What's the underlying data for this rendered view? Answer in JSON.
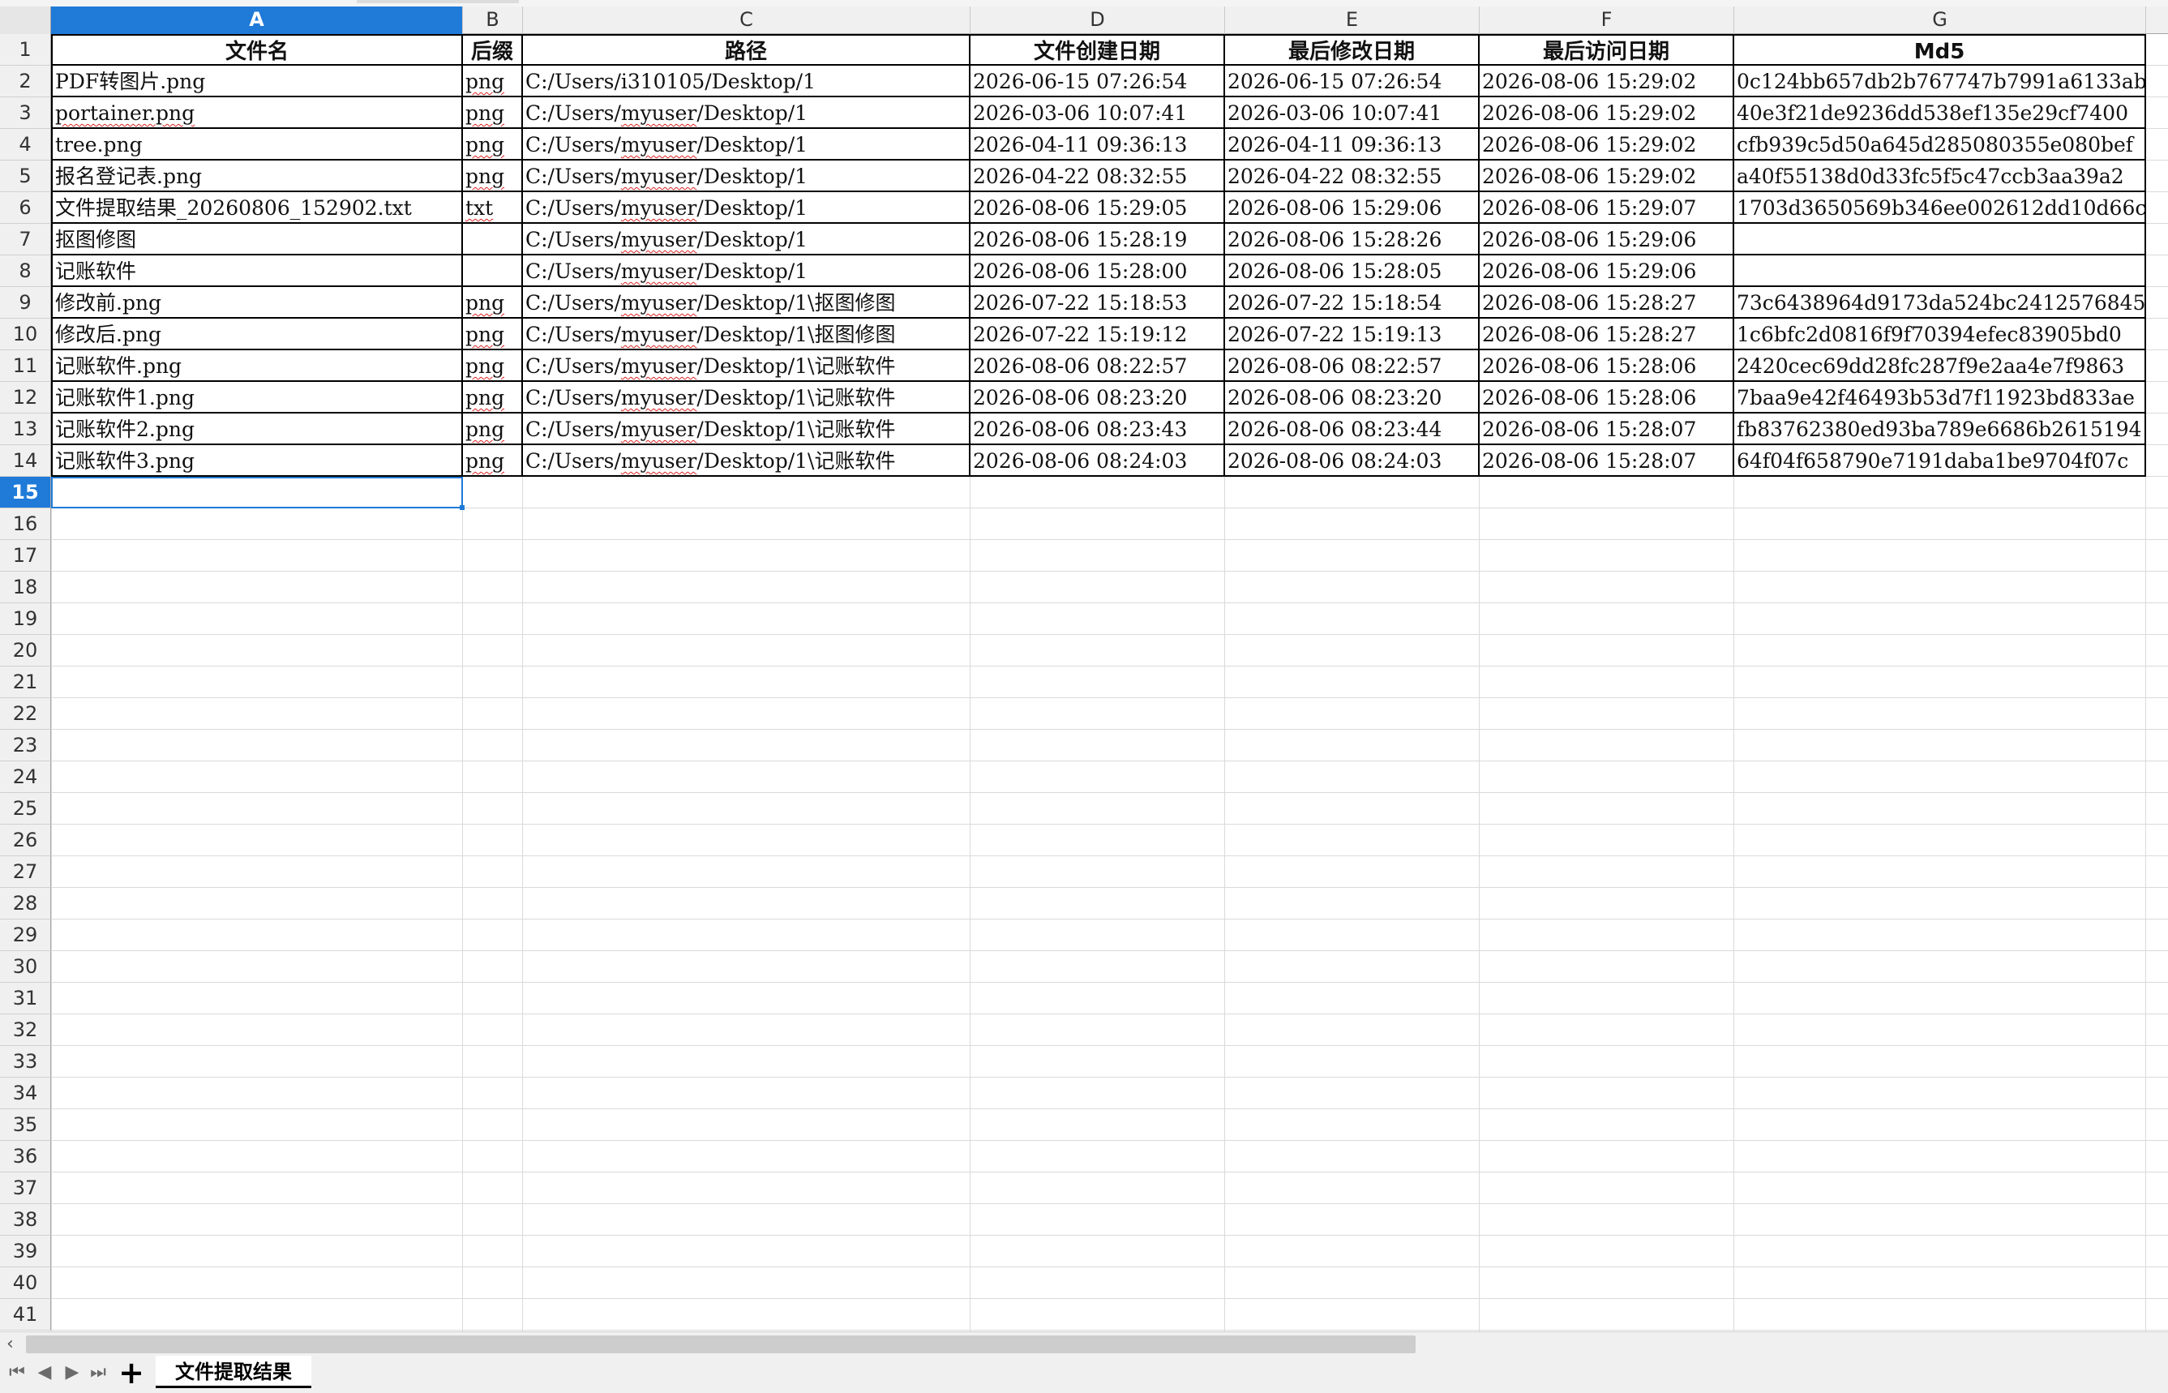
{
  "columns": [
    "A",
    "B",
    "C",
    "D",
    "E",
    "F",
    "G"
  ],
  "active_column": "A",
  "active_row": 15,
  "row_numbers": [
    1,
    2,
    3,
    4,
    5,
    6,
    7,
    8,
    9,
    10,
    11,
    12,
    13,
    14,
    15,
    16,
    17,
    18,
    19,
    20,
    21,
    22,
    23,
    24,
    25,
    26,
    27,
    28,
    29,
    30,
    31,
    32,
    33,
    34,
    35,
    36,
    37,
    38,
    39,
    40,
    41
  ],
  "headers": [
    "文件名",
    "后缀",
    "路径",
    "文件创建日期",
    "最后修改日期",
    "最后访问日期",
    "Md5"
  ],
  "rows": [
    [
      "PDF转图片.png",
      "png",
      "C:/Users/i310105/Desktop/1",
      "2026-06-15 07:26:54",
      "2026-06-15 07:26:54",
      "2026-08-06 15:29:02",
      "0c124bb657db2b767747b7991a6133ab"
    ],
    [
      "portainer.png",
      "png",
      "C:/Users/myuser/Desktop/1",
      "2026-03-06 10:07:41",
      "2026-03-06 10:07:41",
      "2026-08-06 15:29:02",
      "40e3f21de9236dd538ef135e29cf7400"
    ],
    [
      "tree.png",
      "png",
      "C:/Users/myuser/Desktop/1",
      "2026-04-11 09:36:13",
      "2026-04-11 09:36:13",
      "2026-08-06 15:29:02",
      "cfb939c5d50a645d285080355e080bef"
    ],
    [
      "报名登记表.png",
      "png",
      "C:/Users/myuser/Desktop/1",
      "2026-04-22 08:32:55",
      "2026-04-22 08:32:55",
      "2026-08-06 15:29:02",
      "a40f55138d0d33fc5f5c47ccb3aa39a2"
    ],
    [
      "文件提取结果_20260806_152902.txt",
      "txt",
      "C:/Users/myuser/Desktop/1",
      "2026-08-06 15:29:05",
      "2026-08-06 15:29:06",
      "2026-08-06 15:29:07",
      "1703d3650569b346ee002612dd10d66c"
    ],
    [
      "抠图修图",
      "",
      "C:/Users/myuser/Desktop/1",
      "2026-08-06 15:28:19",
      "2026-08-06 15:28:26",
      "2026-08-06 15:29:06",
      ""
    ],
    [
      "记账软件",
      "",
      "C:/Users/myuser/Desktop/1",
      "2026-08-06 15:28:00",
      "2026-08-06 15:28:05",
      "2026-08-06 15:29:06",
      ""
    ],
    [
      "修改前.png",
      "png",
      "C:/Users/myuser/Desktop/1\\抠图修图",
      "2026-07-22 15:18:53",
      "2026-07-22 15:18:54",
      "2026-08-06 15:28:27",
      "73c6438964d9173da524bc2412576845"
    ],
    [
      "修改后.png",
      "png",
      "C:/Users/myuser/Desktop/1\\抠图修图",
      "2026-07-22 15:19:12",
      "2026-07-22 15:19:13",
      "2026-08-06 15:28:27",
      "1c6bfc2d0816f9f70394efec83905bd0"
    ],
    [
      "记账软件.png",
      "png",
      "C:/Users/myuser/Desktop/1\\记账软件",
      "2026-08-06 08:22:57",
      "2026-08-06 08:22:57",
      "2026-08-06 15:28:06",
      "2420cec69dd28fc287f9e2aa4e7f9863"
    ],
    [
      "记账软件1.png",
      "png",
      "C:/Users/myuser/Desktop/1\\记账软件",
      "2026-08-06 08:23:20",
      "2026-08-06 08:23:20",
      "2026-08-06 15:28:06",
      "7baa9e42f46493b53d7f11923bd833ae"
    ],
    [
      "记账软件2.png",
      "png",
      "C:/Users/myuser/Desktop/1\\记账软件",
      "2026-08-06 08:23:43",
      "2026-08-06 08:23:44",
      "2026-08-06 15:28:07",
      "fb83762380ed93ba789e6686b2615194"
    ],
    [
      "记账软件3.png",
      "png",
      "C:/Users/myuser/Desktop/1\\记账软件",
      "2026-08-06 08:24:03",
      "2026-08-06 08:24:03",
      "2026-08-06 15:28:07",
      "64f04f658790e7191daba1be9704f07c"
    ]
  ],
  "sheet_tabs": [
    "文件提取结果"
  ],
  "add_sheet_label": "+",
  "nav_icons": [
    "first-sheet-icon",
    "prev-sheet-icon",
    "next-sheet-icon",
    "last-sheet-icon"
  ],
  "colors": {
    "accent": "#1f7ad8",
    "grid": "#dadada",
    "border": "#000000",
    "spellcheck": "#dd2222"
  }
}
